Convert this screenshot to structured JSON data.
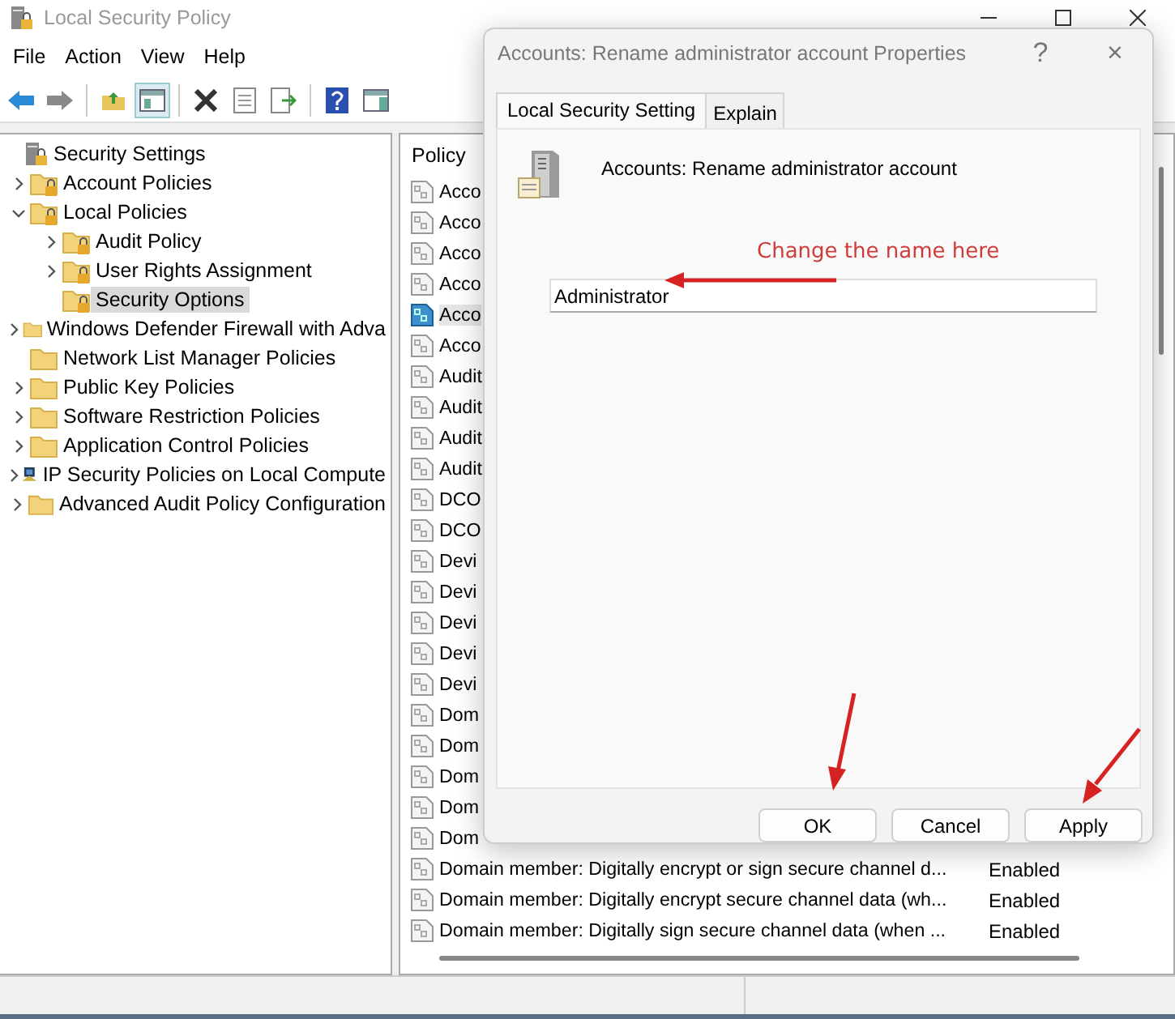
{
  "window": {
    "title": "Local Security Policy"
  },
  "menu": [
    "File",
    "Action",
    "View",
    "Help"
  ],
  "tree": {
    "label": "Security Settings",
    "kind": "root",
    "children": [
      {
        "label": "Account Policies",
        "kind": "locked-folder",
        "expanded": false,
        "selected": false
      },
      {
        "label": "Local Policies",
        "kind": "locked-folder",
        "expanded": true,
        "selected": false,
        "children": [
          {
            "label": "Audit Policy",
            "kind": "locked-folder",
            "expanded": false,
            "selected": false
          },
          {
            "label": "User Rights Assignment",
            "kind": "locked-folder",
            "expanded": false,
            "selected": false
          },
          {
            "label": "Security Options",
            "kind": "locked-folder",
            "selected": true
          }
        ]
      },
      {
        "label": "Windows Defender Firewall with Adva",
        "kind": "folder",
        "expanded": false,
        "selected": false
      },
      {
        "label": "Network List Manager Policies",
        "kind": "folder",
        "selected": false
      },
      {
        "label": "Public Key Policies",
        "kind": "folder",
        "expanded": false,
        "selected": false
      },
      {
        "label": "Software Restriction Policies",
        "kind": "folder",
        "expanded": false,
        "selected": false
      },
      {
        "label": "Application Control Policies",
        "kind": "folder",
        "expanded": false,
        "selected": false
      },
      {
        "label": "IP Security Policies on Local Compute",
        "kind": "network",
        "expanded": false,
        "selected": false
      },
      {
        "label": "Advanced Audit Policy Configuration",
        "kind": "folder",
        "expanded": false,
        "selected": false
      }
    ]
  },
  "policy_list": {
    "column": "Policy",
    "rows": [
      {
        "text": "Acco",
        "selected": false
      },
      {
        "text": "Acco",
        "selected": false
      },
      {
        "text": "Acco",
        "selected": false
      },
      {
        "text": "Acco",
        "selected": false
      },
      {
        "text": "Acco",
        "selected": true
      },
      {
        "text": "Acco",
        "selected": false
      },
      {
        "text": "Audit",
        "selected": false
      },
      {
        "text": "Audit",
        "selected": false
      },
      {
        "text": "Audit",
        "selected": false
      },
      {
        "text": "Audit",
        "selected": false
      },
      {
        "text": "DCO",
        "selected": false
      },
      {
        "text": "DCO",
        "selected": false
      },
      {
        "text": "Devi",
        "selected": false
      },
      {
        "text": "Devi",
        "selected": false
      },
      {
        "text": "Devi",
        "selected": false
      },
      {
        "text": "Devi",
        "selected": false
      },
      {
        "text": "Devi",
        "selected": false
      },
      {
        "text": "Dom",
        "selected": false
      },
      {
        "text": "Dom",
        "selected": false
      },
      {
        "text": "Dom",
        "selected": false
      },
      {
        "text": "Dom",
        "selected": false
      },
      {
        "text": "Dom",
        "selected": false
      },
      {
        "text": "Domain member: Digitally encrypt or sign secure channel d...",
        "setting": "Enabled",
        "selected": false
      },
      {
        "text": "Domain member: Digitally encrypt secure channel data (wh...",
        "setting": "Enabled",
        "selected": false
      },
      {
        "text": "Domain member: Digitally sign secure channel data (when ...",
        "setting": "Enabled",
        "selected": false
      }
    ]
  },
  "dialog": {
    "title": "Accounts: Rename administrator account Properties",
    "help": "?",
    "close": "×",
    "tabs": [
      {
        "label": "Local Security Setting",
        "selected": true
      },
      {
        "label": "Explain",
        "selected": false
      }
    ],
    "policy_name": "Accounts: Rename administrator account",
    "value": "Administrator",
    "annotation": "Change the name here",
    "buttons": [
      "OK",
      "Cancel",
      "Apply"
    ]
  }
}
